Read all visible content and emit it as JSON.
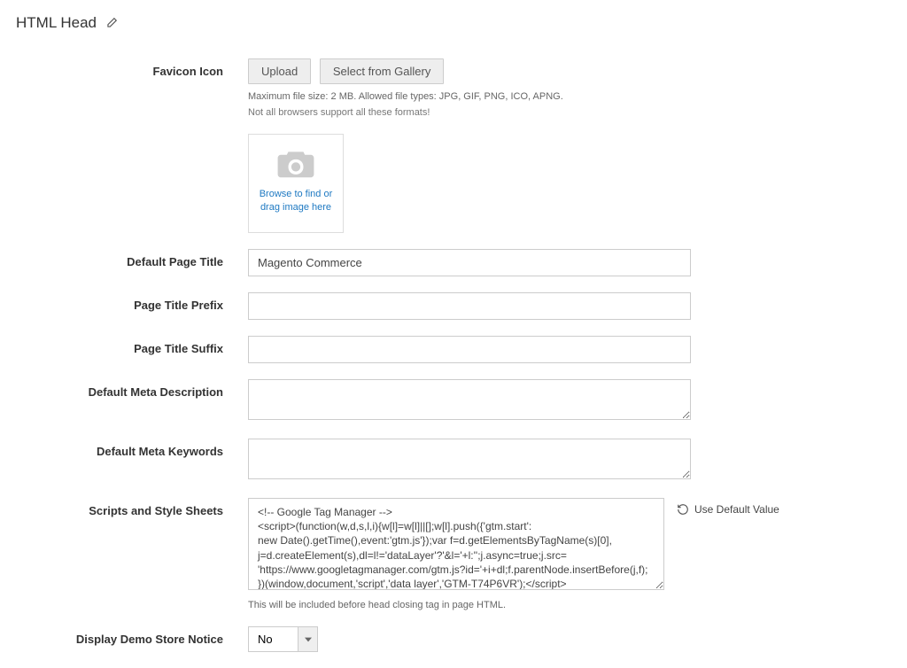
{
  "header": {
    "title": "HTML Head"
  },
  "labels": {
    "favicon": "Favicon Icon",
    "default_page_title": "Default Page Title",
    "page_title_prefix": "Page Title Prefix",
    "page_title_suffix": "Page Title Suffix",
    "default_meta_description": "Default Meta Description",
    "default_meta_keywords": "Default Meta Keywords",
    "scripts_and_style": "Scripts and Style Sheets",
    "display_demo_notice": "Display Demo Store Notice"
  },
  "favicon": {
    "upload_btn": "Upload",
    "select_btn": "Select from Gallery",
    "note1": "Maximum file size: 2 MB. Allowed file types: JPG, GIF, PNG, ICO, APNG.",
    "note2": "Not all browsers support all these formats!",
    "browse_text": "Browse to find or drag image here"
  },
  "fields": {
    "default_page_title": "Magento Commerce",
    "page_title_prefix": "",
    "page_title_suffix": "",
    "default_meta_description": "",
    "default_meta_keywords": "",
    "scripts": "<!-- Google Tag Manager -->\n<script>(function(w,d,s,l,i){w[l]=w[l]||[];w[l].push({'gtm.start':\nnew Date().getTime(),event:'gtm.js'});var f=d.getElementsByTagName(s)[0],\nj=d.createElement(s),dl=l!='dataLayer'?'&l='+l:'';j.async=true;j.src=\n'https://www.googletagmanager.com/gtm.js?id='+i+dl;f.parentNode.insertBefore(j,f);\n})(window,document,'script','data layer','GTM-T74P6VR');</script>\n<!-- End Google Tag Manager -->",
    "scripts_note": "This will be included before head closing tag in page HTML.",
    "display_demo_notice": "No"
  },
  "actions": {
    "use_default": "Use Default Value"
  }
}
